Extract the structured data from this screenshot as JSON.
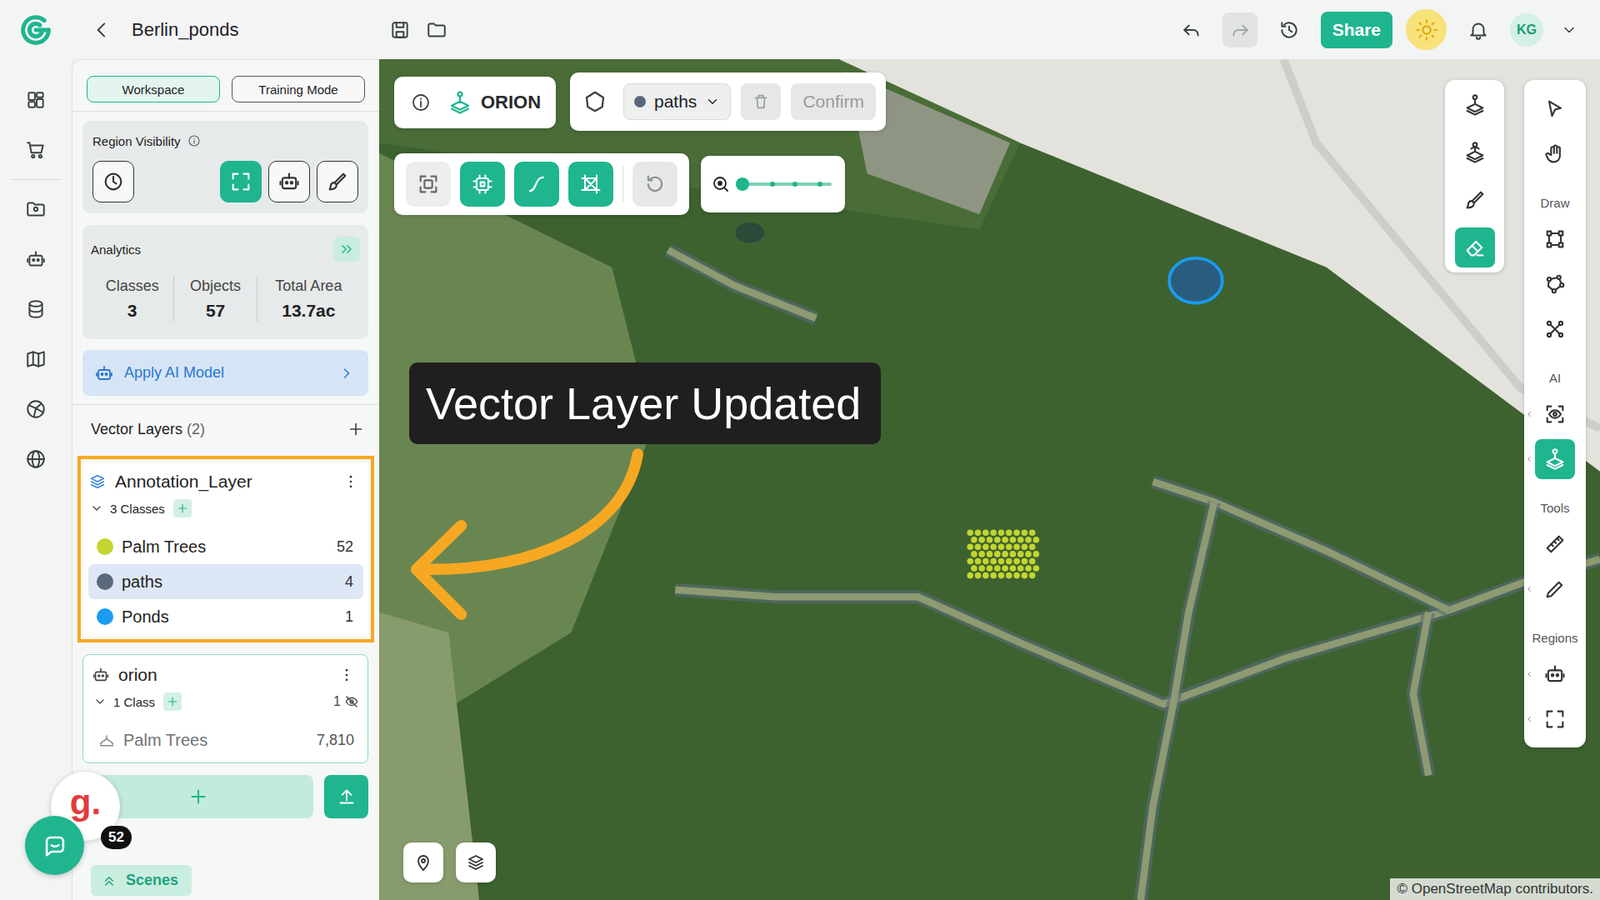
{
  "header": {
    "title": "Berlin_ponds",
    "share": "Share",
    "avatar": "KG",
    "undo": {
      "disabled": false
    },
    "redo": {
      "disabled": true
    }
  },
  "rail": {
    "groups": [
      {
        "items": [
          {
            "kind": "grid",
            "selected": false
          },
          {
            "kind": "cart",
            "selected": false
          }
        ]
      },
      {
        "items": [
          {
            "kind": "folderpin",
            "selected": false
          },
          {
            "kind": "robot",
            "selected": false
          },
          {
            "kind": "database",
            "selected": false
          },
          {
            "kind": "map",
            "selected": false
          },
          {
            "kind": "globenet",
            "selected": false
          },
          {
            "kind": "globe",
            "selected": false
          }
        ]
      }
    ]
  },
  "panel": {
    "tabs": [
      {
        "label": "Workspace",
        "selected": true
      },
      {
        "label": "Training Mode",
        "selected": false
      }
    ],
    "region_visibility": {
      "title": "Region Visibility",
      "toggles": [
        {
          "kind": "clock",
          "selected": false
        },
        {
          "kind": "frame",
          "selected": true
        },
        {
          "kind": "robot",
          "selected": false
        },
        {
          "kind": "brush",
          "selected": false
        }
      ]
    },
    "analytics": {
      "title": "Analytics",
      "stats": [
        {
          "label": "Classes",
          "value": "3"
        },
        {
          "label": "Objects",
          "value": "57"
        },
        {
          "label": "Total Area",
          "value": "13.7ac"
        }
      ]
    },
    "apply_model": {
      "label": "Apply AI Model"
    },
    "vector_layers": {
      "title": "Vector Layers",
      "count": "(2)",
      "layers": [
        {
          "name": "Annotation_Layer",
          "kind": "annotation",
          "highlighted": true,
          "expanded": true,
          "classes_label": "3 Classes",
          "hidden_count": "",
          "classes": [
            {
              "name": "Palm Trees",
              "count": "52",
              "color": "#c3d52f",
              "selected": false,
              "hidden": false
            },
            {
              "name": "paths",
              "count": "4",
              "color": "#5a6a7a",
              "selected": true,
              "hidden": false
            },
            {
              "name": "Ponds",
              "count": "1",
              "color": "#1a9cf0",
              "selected": false,
              "hidden": false
            }
          ]
        },
        {
          "name": "orion",
          "kind": "ai",
          "highlighted": false,
          "expanded": true,
          "classes_label": "1 Class",
          "hidden_count": "1",
          "classes": [
            {
              "name": "Palm Trees",
              "count": "7,810",
              "selected": false,
              "hidden": true
            }
          ]
        }
      ]
    },
    "scenes": {
      "label": "Scenes"
    }
  },
  "chat": {
    "avatar": "g.",
    "badge": "52"
  },
  "map": {
    "model": {
      "name": "ORION"
    },
    "class_picker": {
      "value": "paths",
      "color": "#5a6a7a",
      "delete_disabled": true,
      "confirm": {
        "label": "Confirm",
        "disabled": true
      }
    },
    "tools": [
      {
        "kind": "scan",
        "selected": false,
        "disabled": false
      },
      {
        "kind": "chip",
        "selected": true,
        "disabled": false
      },
      {
        "kind": "curve",
        "selected": true,
        "disabled": false
      },
      {
        "kind": "crop",
        "selected": true,
        "disabled": false
      },
      {
        "kind": "reset",
        "selected": false,
        "disabled": true
      }
    ],
    "slider": {
      "level": 0
    },
    "right_tools": [
      {
        "kind": "orion",
        "selected": false
      },
      {
        "kind": "orionalt",
        "selected": false
      },
      {
        "kind": "brush",
        "selected": false
      },
      {
        "kind": "eraser",
        "selected": true
      }
    ],
    "toolbar": {
      "top": [
        {
          "kind": "cursor",
          "selected": false,
          "has_menu": false
        },
        {
          "kind": "hand",
          "selected": false,
          "has_menu": false
        }
      ],
      "sections": [
        {
          "label": "Draw",
          "tools": [
            {
              "kind": "rect",
              "selected": false,
              "has_menu": false
            },
            {
              "kind": "poly",
              "selected": false,
              "has_menu": false
            },
            {
              "kind": "multi",
              "selected": false,
              "has_menu": false
            }
          ]
        },
        {
          "label": "AI",
          "tools": [
            {
              "kind": "eyescan",
              "selected": false,
              "has_menu": true
            },
            {
              "kind": "orion",
              "selected": true,
              "has_menu": true
            }
          ]
        },
        {
          "label": "Tools",
          "tools": [
            {
              "kind": "ruler",
              "selected": false,
              "has_menu": false
            },
            {
              "kind": "pen",
              "selected": false,
              "has_menu": true
            }
          ]
        },
        {
          "label": "Regions",
          "tools": [
            {
              "kind": "robot",
              "selected": false,
              "has_menu": true
            },
            {
              "kind": "frame",
              "selected": false,
              "has_menu": true
            }
          ]
        }
      ]
    },
    "tooltip": "Vector Layer Updated",
    "map_buttons": [
      {
        "kind": "pin"
      },
      {
        "kind": "layers"
      }
    ],
    "attribution": "© OpenStreetMap contributors."
  }
}
